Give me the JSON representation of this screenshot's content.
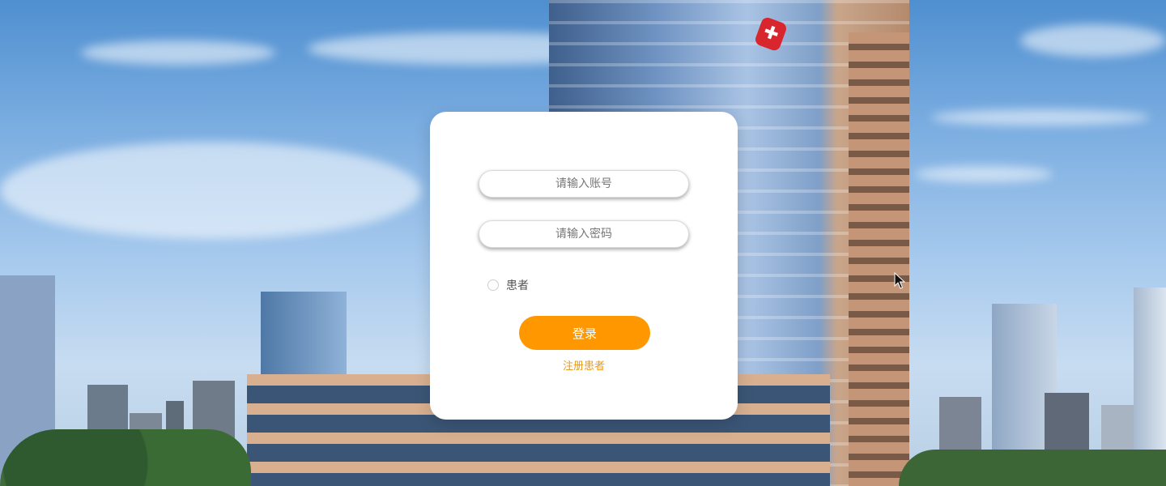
{
  "login_form": {
    "account_placeholder": "请输入账号",
    "password_placeholder": "请输入密码",
    "role_option_label": "患者",
    "login_button_label": "登录",
    "register_link_label": "注册患者"
  },
  "colors": {
    "primary_button": "#ff9800",
    "link": "#e89a1b",
    "card_background": "#ffffff"
  },
  "icons": {
    "hospital_logo": "hospital-cross-icon",
    "radio": "radio-unchecked-icon"
  }
}
